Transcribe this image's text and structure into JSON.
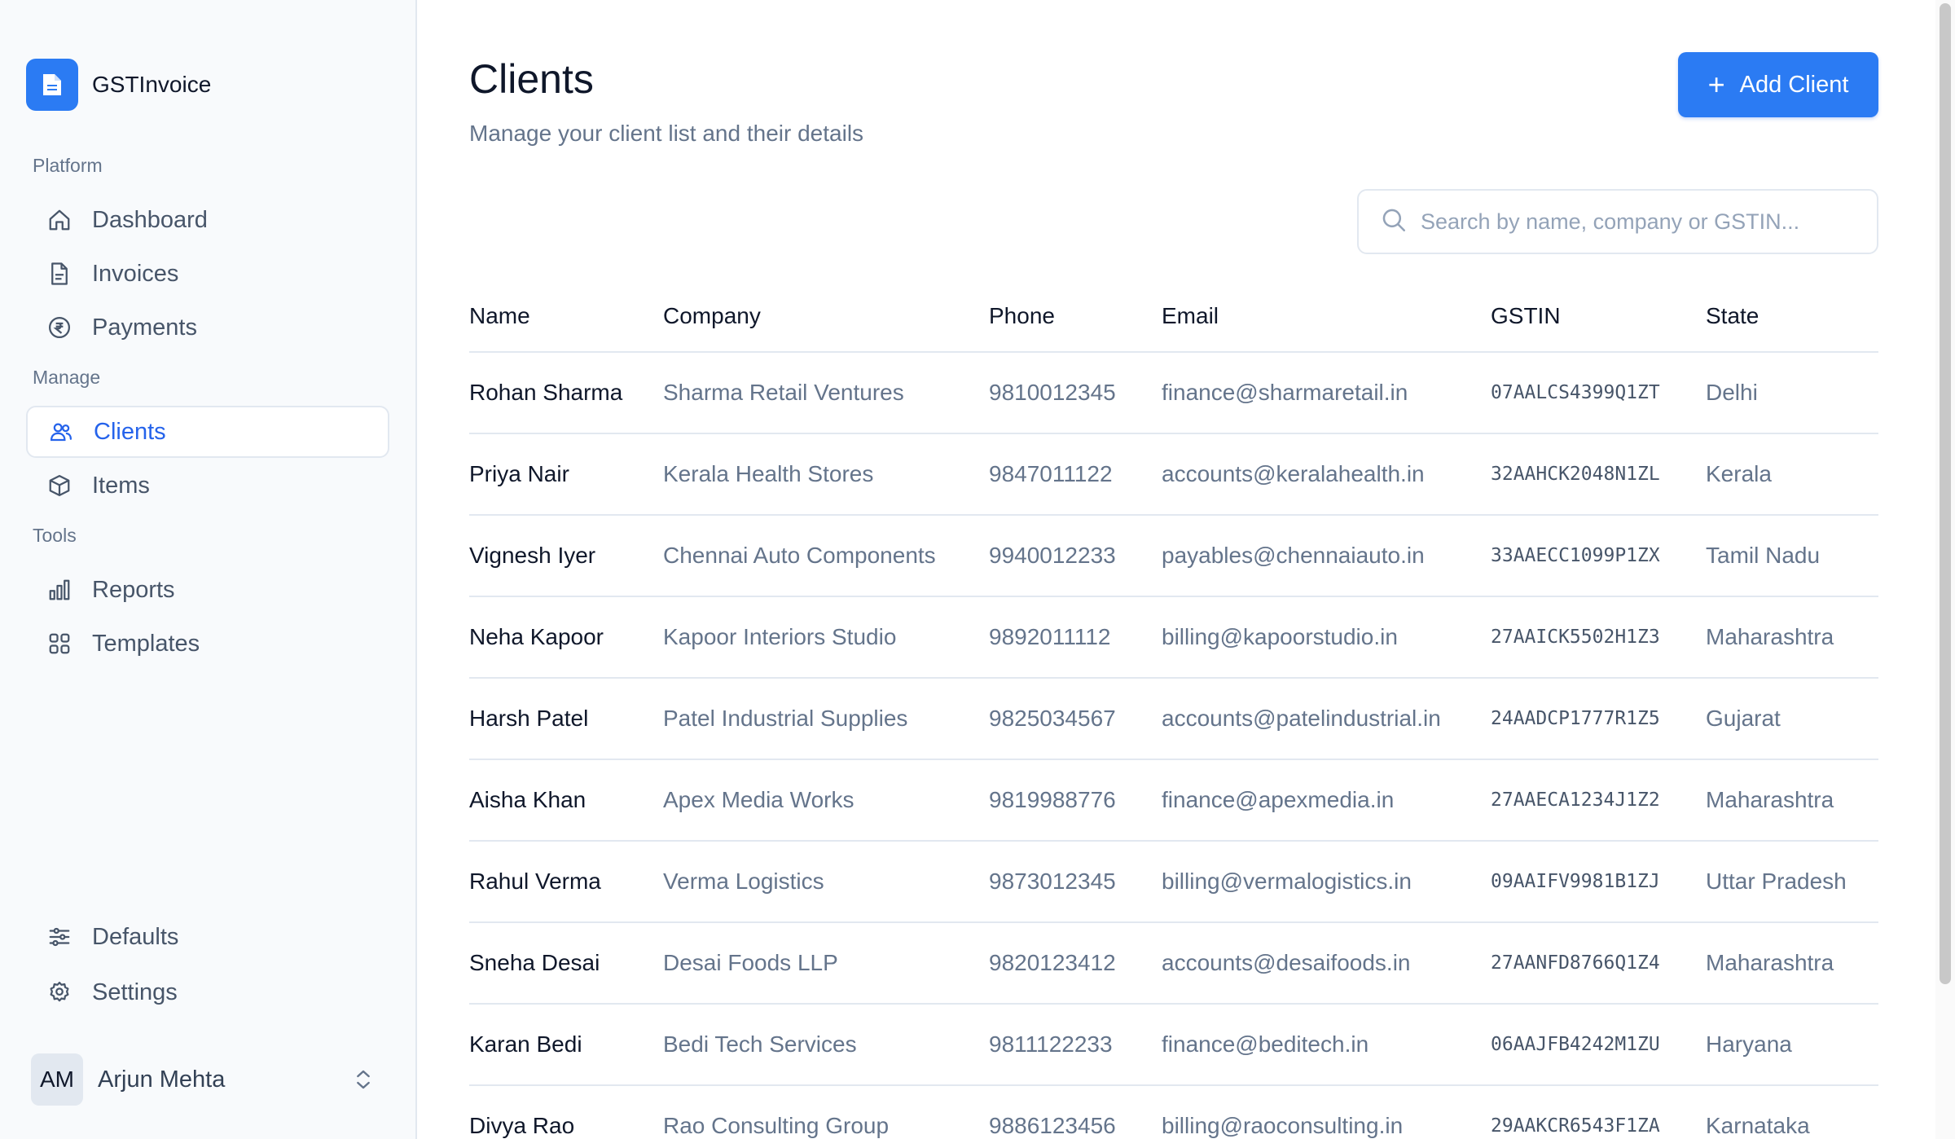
{
  "app": {
    "name": "GSTInvoice"
  },
  "sidebar": {
    "sections": [
      {
        "label": "Platform"
      },
      {
        "label": "Manage"
      },
      {
        "label": "Tools"
      }
    ],
    "items": [
      {
        "label": "Dashboard",
        "icon": "home-icon"
      },
      {
        "label": "Invoices",
        "icon": "document-icon"
      },
      {
        "label": "Payments",
        "icon": "rupee-icon"
      },
      {
        "label": "Clients",
        "icon": "users-icon",
        "active": true
      },
      {
        "label": "Items",
        "icon": "box-icon"
      },
      {
        "label": "Reports",
        "icon": "bar-chart-icon"
      },
      {
        "label": "Templates",
        "icon": "grid-icon"
      },
      {
        "label": "Defaults",
        "icon": "sliders-icon"
      },
      {
        "label": "Settings",
        "icon": "gear-icon"
      }
    ],
    "user": {
      "initials": "AM",
      "name": "Arjun Mehta"
    }
  },
  "page": {
    "title": "Clients",
    "subtitle": "Manage your client list and their details",
    "add_button": "Add Client",
    "search_placeholder": "Search by name, company or GSTIN..."
  },
  "table": {
    "headers": [
      "Name",
      "Company",
      "Phone",
      "Email",
      "GSTIN",
      "State"
    ],
    "rows": [
      [
        "Rohan Sharma",
        "Sharma Retail Ventures",
        "9810012345",
        "finance@sharmaretail.in",
        "07AALCS4399Q1ZT",
        "Delhi"
      ],
      [
        "Priya Nair",
        "Kerala Health Stores",
        "9847011122",
        "accounts@keralahealth.in",
        "32AAHCK2048N1ZL",
        "Kerala"
      ],
      [
        "Vignesh Iyer",
        "Chennai Auto Components",
        "9940012233",
        "payables@chennaiauto.in",
        "33AAECC1099P1ZX",
        "Tamil Nadu"
      ],
      [
        "Neha Kapoor",
        "Kapoor Interiors Studio",
        "9892011112",
        "billing@kapoorstudio.in",
        "27AAICK5502H1Z3",
        "Maharashtra"
      ],
      [
        "Harsh Patel",
        "Patel Industrial Supplies",
        "9825034567",
        "accounts@patelindustrial.in",
        "24AADCP1777R1Z5",
        "Gujarat"
      ],
      [
        "Aisha Khan",
        "Apex Media Works",
        "9819988776",
        "finance@apexmedia.in",
        "27AAECA1234J1Z2",
        "Maharashtra"
      ],
      [
        "Rahul Verma",
        "Verma Logistics",
        "9873012345",
        "billing@vermalogistics.in",
        "09AAIFV9981B1ZJ",
        "Uttar Pradesh"
      ],
      [
        "Sneha Desai",
        "Desai Foods LLP",
        "9820123412",
        "accounts@desaifoods.in",
        "27AANFD8766Q1Z4",
        "Maharashtra"
      ],
      [
        "Karan Bedi",
        "Bedi Tech Services",
        "9811122233",
        "finance@beditech.in",
        "06AAJFB4242M1ZU",
        "Haryana"
      ],
      [
        "Divya Rao",
        "Rao Consulting Group",
        "9886123456",
        "billing@raoconsulting.in",
        "29AAKCR6543F1ZA",
        "Karnataka"
      ]
    ]
  },
  "colors": {
    "accent": "#2b7bf3",
    "active_text": "#2563eb",
    "muted": "#64748b",
    "border": "#e2e8f0"
  }
}
